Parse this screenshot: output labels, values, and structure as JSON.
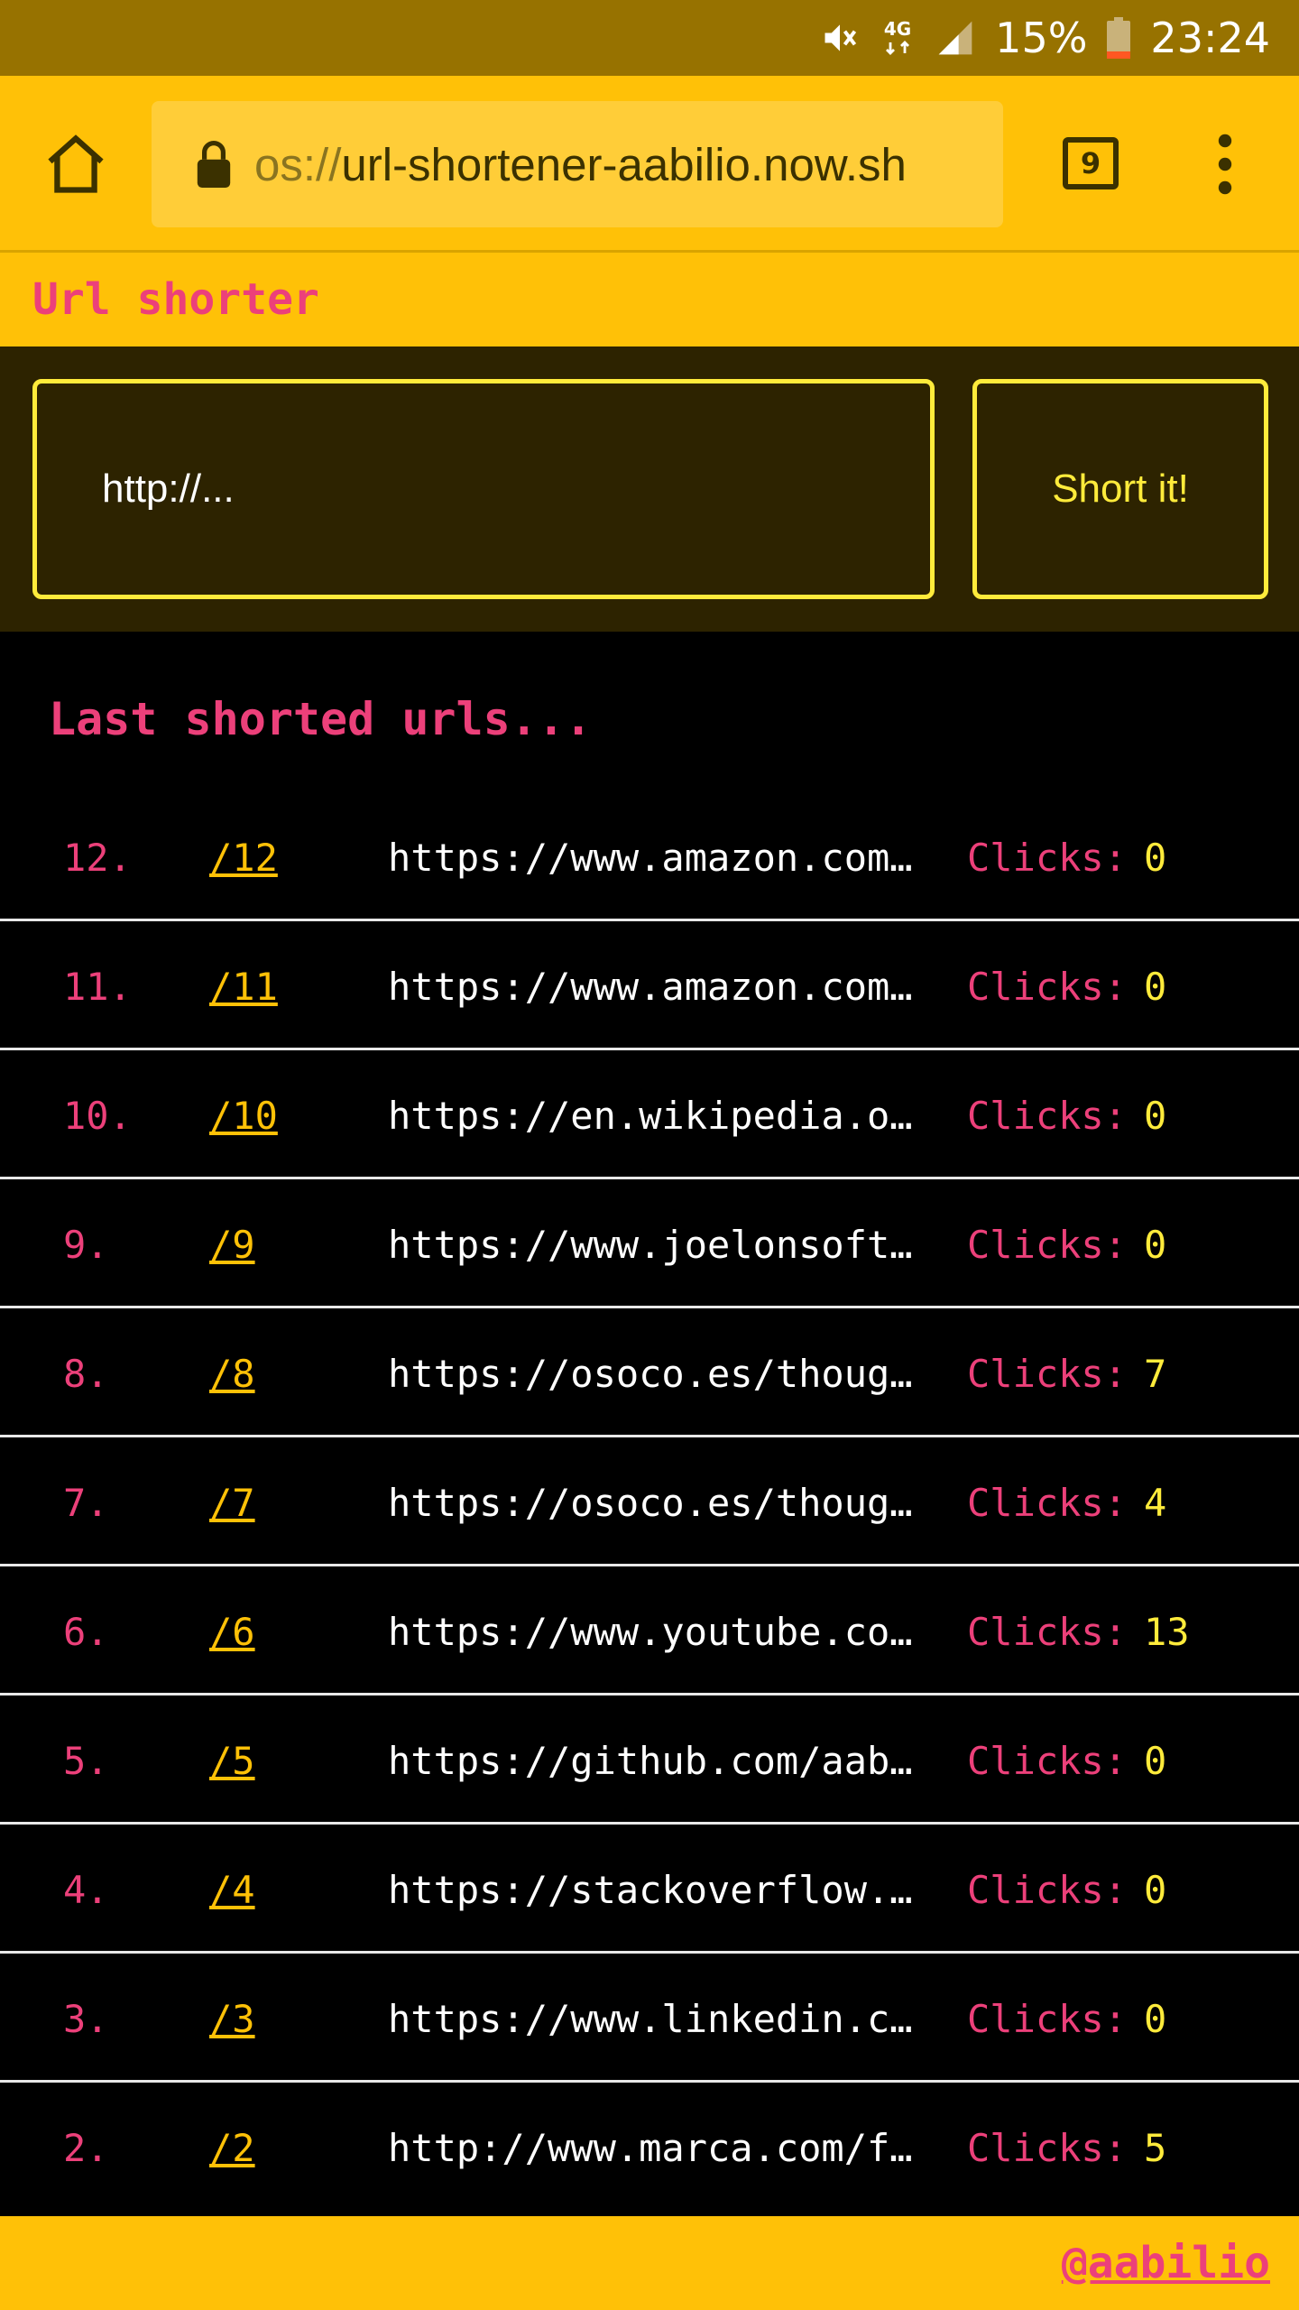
{
  "status_bar": {
    "battery": "15%",
    "time": "23:24",
    "network": "4G",
    "icons": [
      "mute-icon",
      "network-4g-icon",
      "signal-icon",
      "battery-icon"
    ]
  },
  "browser": {
    "url_prefix": "os://",
    "url_main": "url-shortener-aabilio.now.sh",
    "tab_count": "9",
    "icons": [
      "home-icon",
      "lock-icon",
      "tabs-icon",
      "more-vert-icon"
    ]
  },
  "app": {
    "title": "Url shorter",
    "input_placeholder": "http://...",
    "submit_label": "Short it!",
    "list_title": "Last shorted urls...",
    "clicks_label": "Clicks:",
    "footer_link": "@aabilio"
  },
  "rows": [
    {
      "num": "12.",
      "short": "/12",
      "url": "https://www.amazon.com/…",
      "clicks": "0"
    },
    {
      "num": "11.",
      "short": "/11",
      "url": "https://www.amazon.com/…",
      "clicks": "0"
    },
    {
      "num": "10.",
      "short": "/10",
      "url": "https://en.wikipedia.or…",
      "clicks": "0"
    },
    {
      "num": "9.",
      "short": "/9",
      "url": "https://www.joelonsoftw…",
      "clicks": "0"
    },
    {
      "num": "8.",
      "short": "/8",
      "url": "https://osoco.es/though…",
      "clicks": "7"
    },
    {
      "num": "7.",
      "short": "/7",
      "url": "https://osoco.es/though…",
      "clicks": "4"
    },
    {
      "num": "6.",
      "short": "/6",
      "url": "https://www.youtube.com…",
      "clicks": "13"
    },
    {
      "num": "5.",
      "short": "/5",
      "url": "https://github.com/aabi…",
      "clicks": "0"
    },
    {
      "num": "4.",
      "short": "/4",
      "url": "https://stackoverflow.c…",
      "clicks": "0"
    },
    {
      "num": "3.",
      "short": "/3",
      "url": "https://www.linkedin.co…",
      "clicks": "0"
    },
    {
      "num": "2.",
      "short": "/2",
      "url": "http://www.marca.com/fu…",
      "clicks": "5"
    }
  ],
  "colors": {
    "status_bar": "#977200",
    "amber": "#ffc107",
    "pink": "#ec407a",
    "yellow": "#ffeb3b",
    "form_bg": "#2d2300",
    "list_bg": "#000000"
  }
}
